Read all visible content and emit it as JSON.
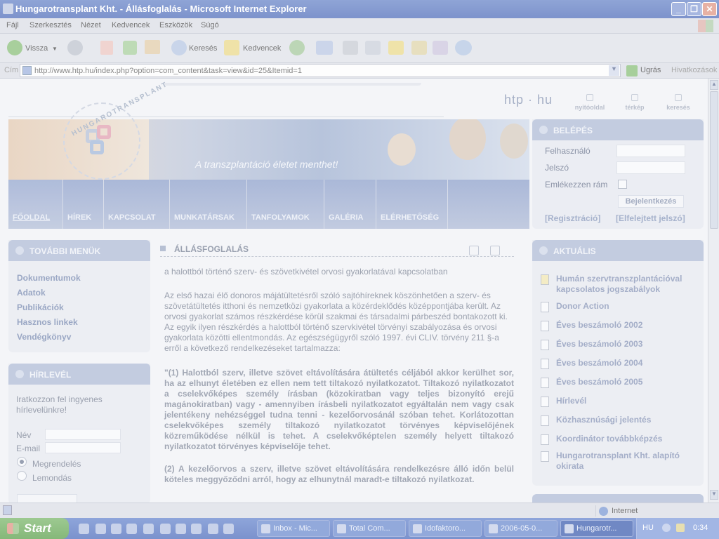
{
  "window": {
    "title": "Hungarotransplant Kht. - Állásfoglalás - Microsoft Internet Explorer"
  },
  "menubar": [
    "Fájl",
    "Szerkesztés",
    "Nézet",
    "Kedvencek",
    "Eszközök",
    "Súgó"
  ],
  "toolbar": {
    "back": "Vissza",
    "search": "Keresés",
    "favorites": "Kedvencek"
  },
  "address": {
    "label": "Cím",
    "url": "http://www.htp.hu/index.php?option=com_content&task=view&id=25&Itemid=1",
    "go": "Ugrás",
    "links": "Hivatkozások"
  },
  "site": {
    "domain": "htp · hu",
    "topnav": [
      "nyitóoldal",
      "térkép",
      "keresés"
    ],
    "logo_text": "HUNGAROTRANSPLANT",
    "slogan": "A transzplantáció életet menthet!",
    "nav": [
      "FŐOLDAL",
      "HÍREK",
      "KAPCSOLAT",
      "MUNKATÁRSAK",
      "TANFOLYAMOK",
      "GALÉRIA",
      "ELÉRHETŐSÉG"
    ]
  },
  "login": {
    "title": "BELÉPÉS",
    "username_label": "Felhasználó",
    "password_label": "Jelszó",
    "remember_label": "Emlékezzen rám",
    "submit": "Bejelentkezés",
    "register": "[Regisztráció]",
    "forgot": "[Elfelejtett jelszó]"
  },
  "more_menu": {
    "title": "TOVÁBBI MENÜK",
    "items": [
      "Dokumentumok",
      "Adatok",
      "Publikációk",
      "Hasznos linkek",
      "Vendégkönyv"
    ]
  },
  "newsletter": {
    "title": "HÍRLEVÉL",
    "intro": "Iratkozzon fel ingyenes hírlevelünkre!",
    "name_label": "Név",
    "email_label": "E-mail",
    "subscribe": "Megrendelés",
    "unsubscribe": "Lemondás"
  },
  "article": {
    "title": "ÁLLÁSFOGLALÁS",
    "subtitle": "a halottból történő szerv- és szövetkivétel orvosi gyakorlatával kapcsolatban",
    "p1": "Az első hazai élő donoros májátültetésről szóló sajtóhíreknek köszönhetően a szerv- és szövetátültetés itthoni és nemzetközi gyakorlata a közérdeklődés középpontjába került. Az orvosi gyakorlat számos részkérdése körül szakmai és társadalmi párbeszéd bontakozott ki. Az egyik ilyen részkérdés a halottból történő szervkivétel törvényi szabályozása és orvosi gyakorlata közötti ellentmondás. Az egészségügyről szóló 1997. évi CLIV. törvény 211 §-a erről a következő rendelkezéseket tartalmazza:",
    "p2": "\"(1) Halottból szerv, illetve szövet eltávolítására átültetés céljából akkor kerülhet sor, ha az elhunyt életében ez ellen nem tett tiltakozó nyilatkozatot. Tiltakozó nyilatkozatot a cselekvőképes személy írásban (közokiratban vagy teljes bizonyító erejű magánokiratban) vagy - amennyiben írásbeli nyilatkozatot egyáltalán nem vagy csak jelentékeny nehézséggel tudna tenni - kezelőorvosánál szóban tehet. Korlátozottan cselekvőképes személy tiltakozó nyilatkozatot törvényes képviselőjének közreműködése nélkül is tehet. A cselekvőképtelen személy helyett tiltakozó nyilatkozatot törvényes képviselője tehet.",
    "p3": "(2) A kezelőorvos a szerv, illetve szövet eltávolítására rendelkezésre álló időn belül köteles meggyőződni arról, hogy az elhunytnál maradt-e tiltakozó nyilatkozat."
  },
  "aktualis": {
    "title": "AKTUÁLIS",
    "items": [
      "Humán szervtranszplantációval kapcsolatos jogszabályok",
      "Donor Action",
      "Éves beszámoló 2002",
      "Éves beszámoló 2003",
      "Éves beszámoló 2004",
      "Éves beszámoló 2005",
      "Hírlevél",
      "Közhasznúsági jelentés",
      "Koordinátor továbbképzés",
      "Hungarotransplant Kht. alapító okirata"
    ]
  },
  "status": {
    "zone": "Internet"
  },
  "taskbar": {
    "start": "Start",
    "tasks": [
      "Inbox - Mic...",
      "Total Com...",
      "Idofaktoro...",
      "2006-05-0...",
      "Hungarotr..."
    ],
    "lang": "HU",
    "clock": "0:34"
  }
}
